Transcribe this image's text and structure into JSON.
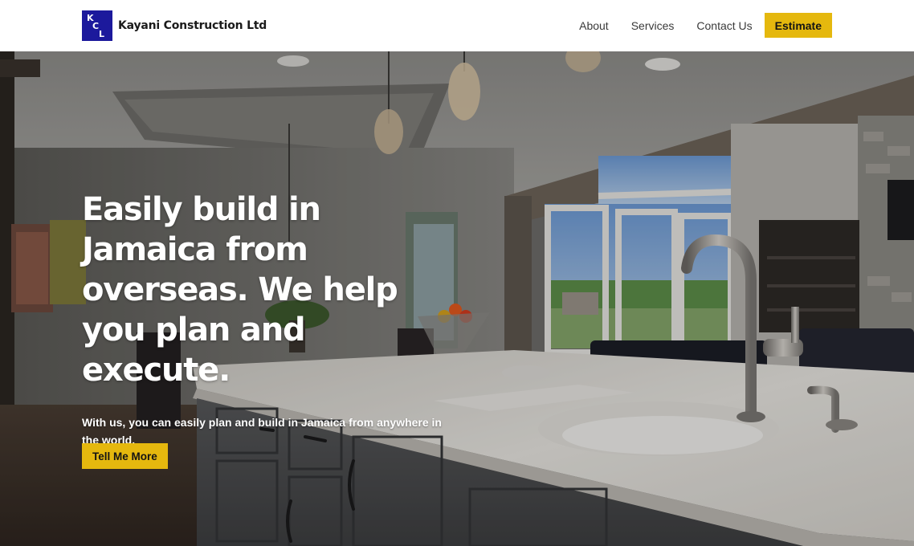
{
  "header": {
    "logo_letters": [
      "K",
      "C",
      "L"
    ],
    "brand_name": "Kayani Construction Ltd",
    "nav": [
      {
        "label": "About"
      },
      {
        "label": "Services"
      },
      {
        "label": "Contact Us"
      }
    ],
    "estimate_label": "Estimate"
  },
  "hero": {
    "title": "Easily build in Jamaica from overseas. We help you plan and execute.",
    "subtitle": "With us, you can easily plan and build in Jamaica from anywhere in the world.",
    "cta_label": "Tell Me More"
  },
  "colors": {
    "logo_bg": "#1c199c",
    "accent": "#e5b80e",
    "header_bg": "#ffffff",
    "nav_text": "#3a3a3a"
  }
}
